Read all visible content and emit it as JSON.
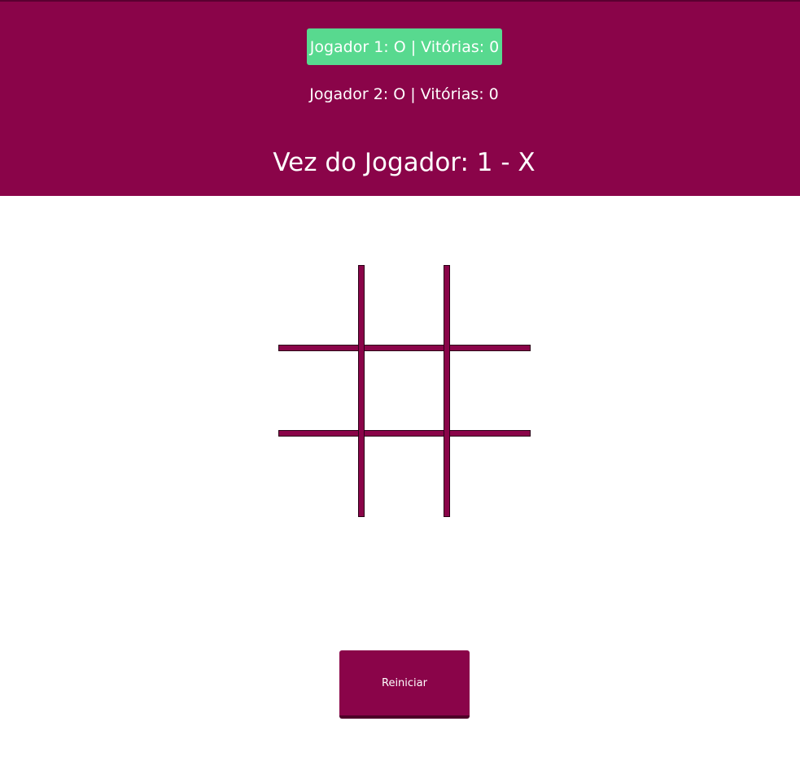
{
  "scoreboard": {
    "player1": "Jogador 1: O | Vitórias: 0",
    "player2": "Jogador 2: O | Vitórias: 0",
    "turn": "Vez do Jogador: 1 - X"
  },
  "board": {
    "cells": [
      "",
      "",
      "",
      "",
      "",
      "",
      "",
      "",
      ""
    ]
  },
  "controls": {
    "restart_label": "Reiniciar"
  },
  "colors": {
    "primary": "#8a0449",
    "active_player": "#58d98f",
    "text": "#ffffff"
  }
}
